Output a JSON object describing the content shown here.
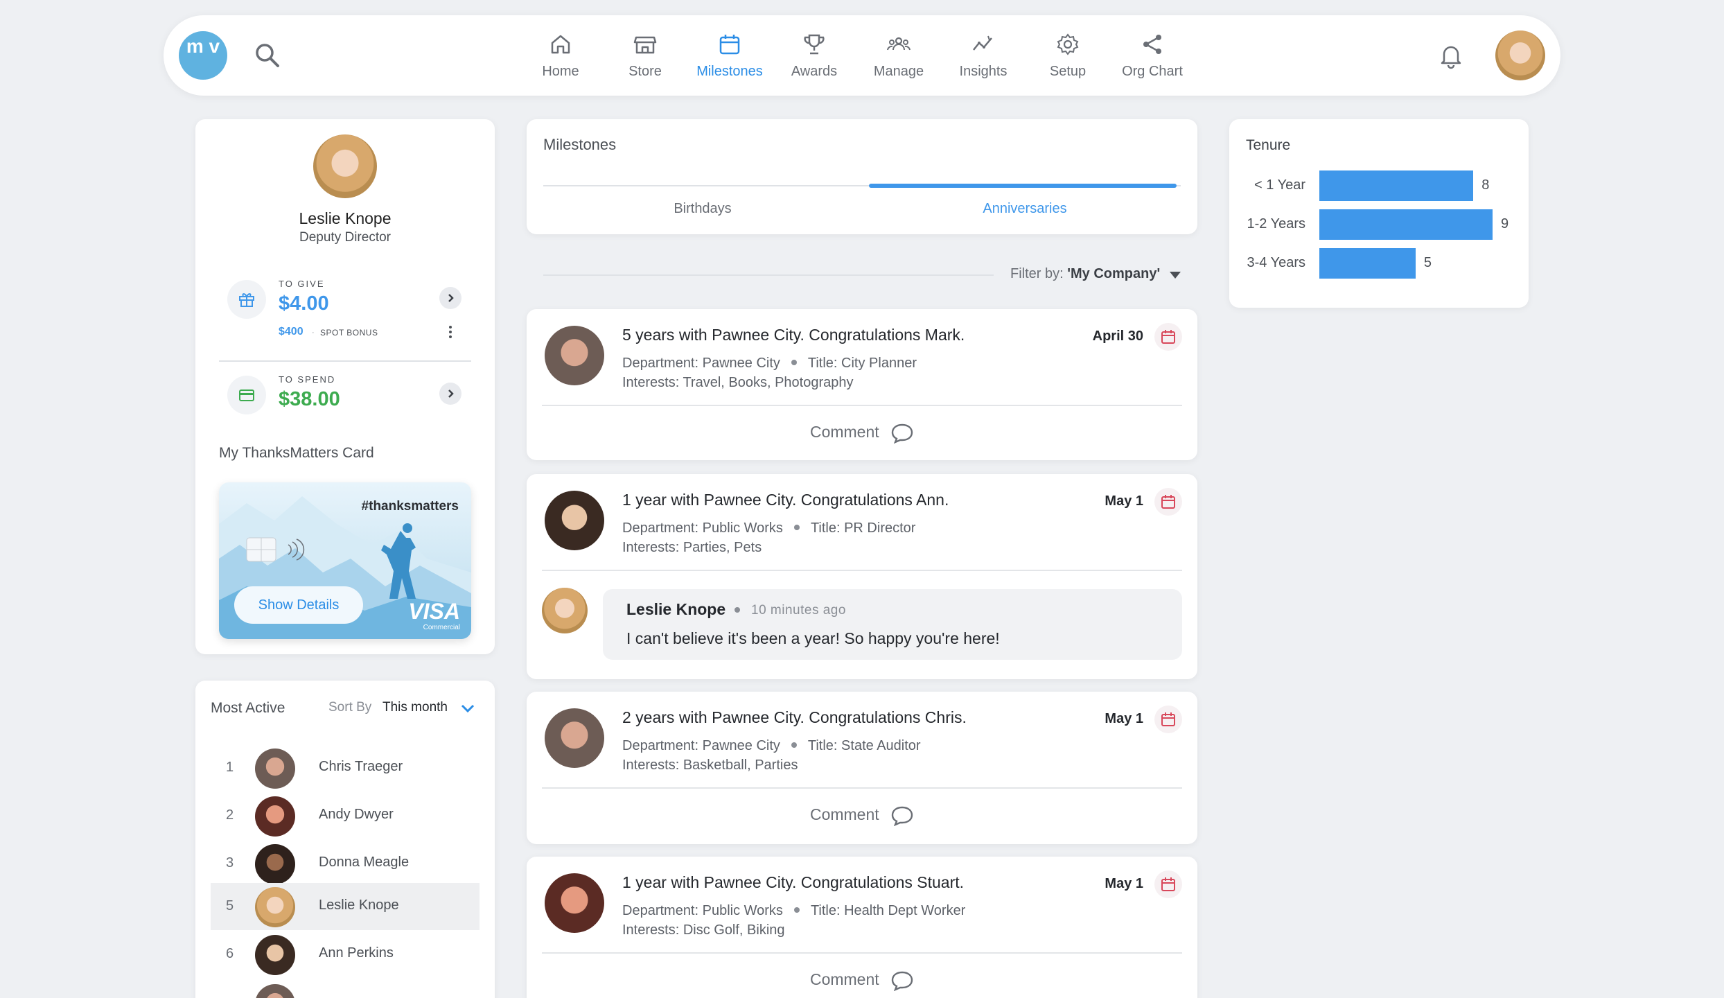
{
  "nav": {
    "logo_text": "m v",
    "items": [
      {
        "label": "Home",
        "icon": "home-icon"
      },
      {
        "label": "Store",
        "icon": "store-icon"
      },
      {
        "label": "Milestones",
        "icon": "calendar-icon",
        "active": true
      },
      {
        "label": "Awards",
        "icon": "trophy-icon"
      },
      {
        "label": "Manage",
        "icon": "people-icon"
      },
      {
        "label": "Insights",
        "icon": "insights-icon"
      },
      {
        "label": "Setup",
        "icon": "gear-icon"
      },
      {
        "label": "Org Chart",
        "icon": "share-icon"
      }
    ]
  },
  "profile": {
    "name": "Leslie Knope",
    "title": "Deputy Director",
    "to_give": {
      "label": "TO GIVE",
      "amount": "$4.00",
      "bonus": "$400",
      "bonus_label": "SPOT BONUS"
    },
    "to_spend": {
      "label": "TO SPEND",
      "amount": "$38.00"
    },
    "card_heading": "My ThanksMatters Card",
    "card": {
      "hashtag": "#thanksmatters",
      "show_details": "Show Details",
      "brand": "VISA",
      "brand_sub": "Commercial"
    }
  },
  "most_active": {
    "title": "Most Active",
    "sort_label": "Sort By",
    "sort_value": "This month",
    "rows": [
      {
        "rank": "1",
        "name": "Chris Traeger"
      },
      {
        "rank": "2",
        "name": "Andy Dwyer"
      },
      {
        "rank": "3",
        "name": "Donna Meagle"
      },
      {
        "rank": "5",
        "name": "Leslie Knope",
        "selected": true
      },
      {
        "rank": "6",
        "name": "Ann Perkins"
      }
    ]
  },
  "milestones": {
    "title": "Milestones",
    "tabs": [
      {
        "label": "Birthdays"
      },
      {
        "label": "Anniversaries",
        "active": true
      }
    ],
    "filter_label": "Filter by:",
    "filter_value": "'My Company'"
  },
  "posts": [
    {
      "title": "5 years with Pawnee City. Congratulations Mark.",
      "department": "Department: Pawnee City",
      "job_title": "Title: City Planner",
      "interests": "Interests: Travel, Books, Photography",
      "date": "April 30",
      "comment_label": "Comment"
    },
    {
      "title": "1 year with Pawnee City. Congratulations Ann.",
      "department": "Department: Public Works",
      "job_title": "Title: PR Director",
      "interests": "Interests: Parties, Pets",
      "date": "May 1",
      "comment": {
        "author": "Leslie Knope",
        "time": "10 minutes ago",
        "text": "I can't believe it's been a year! So happy you're here!"
      }
    },
    {
      "title": "2 years with Pawnee City. Congratulations Chris.",
      "department": "Department: Pawnee City",
      "job_title": "Title: State Auditor",
      "interests": "Interests: Basketball, Parties",
      "date": "May 1",
      "comment_label": "Comment"
    },
    {
      "title": "1 year with Pawnee City. Congratulations Stuart.",
      "department": "Department: Public Works",
      "job_title": "Title: Health Dept Worker",
      "interests": "Interests: Disc Golf, Biking",
      "date": "May 1",
      "comment_label": "Comment"
    }
  ],
  "tenure": {
    "title": "Tenure",
    "rows": [
      {
        "label": "< 1 Year",
        "value": 8
      },
      {
        "label": "1-2 Years",
        "value": 9
      },
      {
        "label": "3-4 Years",
        "value": 5
      }
    ]
  },
  "colors": {
    "accent": "#3f97ea",
    "green": "#3dab4f",
    "calendar_red": "#d8475a",
    "logo": "#5fb2e0"
  }
}
